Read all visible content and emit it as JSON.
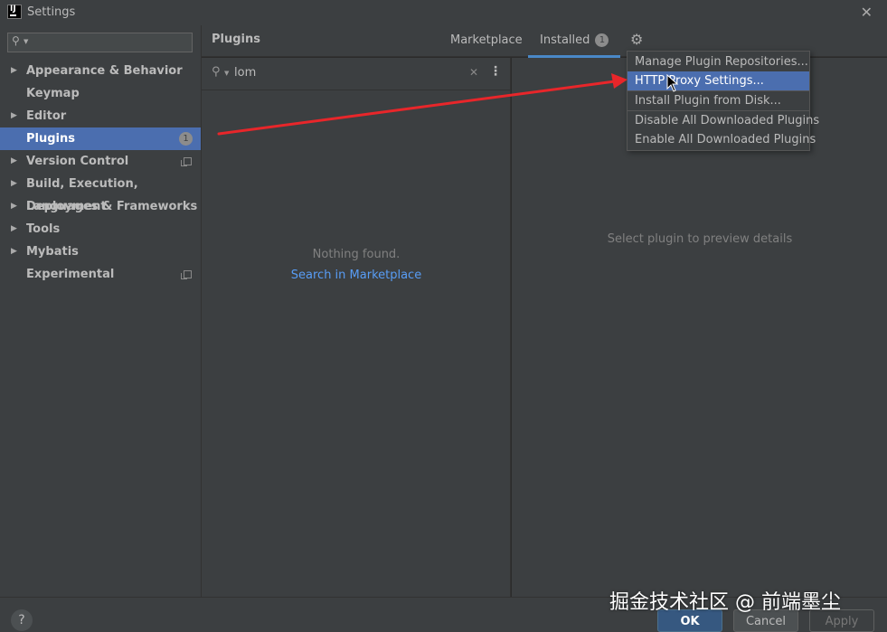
{
  "window": {
    "title": "Settings",
    "logo_text": "IJ",
    "close_glyph": "✕"
  },
  "sidebar": {
    "search_value": "",
    "items": [
      {
        "label": "Appearance & Behavior",
        "expandable": true
      },
      {
        "label": "Keymap",
        "expandable": false
      },
      {
        "label": "Editor",
        "expandable": true
      },
      {
        "label": "Plugins",
        "expandable": false,
        "selected": true,
        "badge": "1"
      },
      {
        "label": "Version Control",
        "expandable": true
      },
      {
        "label": "Build, Execution, Deployment",
        "expandable": true
      },
      {
        "label": "Languages & Frameworks",
        "expandable": true
      },
      {
        "label": "Tools",
        "expandable": true
      },
      {
        "label": "Mybatis",
        "expandable": true
      },
      {
        "label": "Experimental",
        "expandable": false
      }
    ]
  },
  "header": {
    "title": "Plugins",
    "tabs": [
      {
        "label": "Marketplace"
      },
      {
        "label": "Installed",
        "count": "1",
        "active": true
      }
    ]
  },
  "plugin_list": {
    "search_query": "lom",
    "empty_message": "Nothing found.",
    "marketplace_link": "Search in Marketplace"
  },
  "details": {
    "hint": "Select plugin to preview details"
  },
  "gear_menu": {
    "items": [
      "Manage Plugin Repositories...",
      "HTTP Proxy Settings...",
      "Install Plugin from Disk...",
      "Disable All Downloaded Plugins",
      "Enable All Downloaded Plugins"
    ],
    "highlighted_index": 1
  },
  "footer": {
    "help": "?",
    "ok": "OK",
    "cancel": "Cancel",
    "apply": "Apply"
  },
  "watermark": "掘金技术社区 @ 前端墨尘",
  "colors": {
    "selection": "#4b6eaf",
    "link": "#589df6",
    "annotation_arrow": "#e8262a"
  },
  "icons": {
    "arrow": "triangle-right-icon",
    "gear": "gear-icon",
    "search": "search-icon"
  }
}
